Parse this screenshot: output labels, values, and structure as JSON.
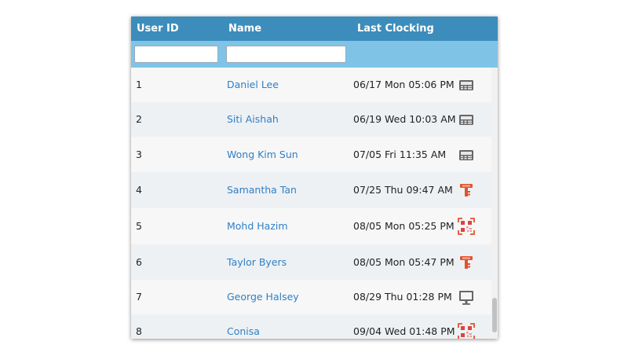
{
  "table": {
    "columns": [
      "User ID",
      "Name",
      "Last Clocking"
    ],
    "filters": {
      "user_id_value": "",
      "name_value": ""
    },
    "rows": [
      {
        "id": "1",
        "name": "Daniel Lee",
        "last": "06/17 Mon 05:06 PM",
        "icon": "terminal-icon"
      },
      {
        "id": "2",
        "name": "Siti Aishah",
        "last": "06/19 Wed 10:03 AM",
        "icon": "terminal-icon"
      },
      {
        "id": "3",
        "name": "Wong Kim Sun",
        "last": "07/05 Fri 11:35 AM",
        "icon": "terminal-icon"
      },
      {
        "id": "4",
        "name": "Samantha Tan",
        "last": "07/25 Thu 09:47 AM",
        "icon": "key-icon"
      },
      {
        "id": "5",
        "name": "Mohd Hazim",
        "last": "08/05 Mon 05:25 PM",
        "icon": "qr-code-icon"
      },
      {
        "id": "6",
        "name": "Taylor Byers",
        "last": "08/05 Mon 05:47 PM",
        "icon": "key-icon"
      },
      {
        "id": "7",
        "name": "George Halsey",
        "last": "08/29 Thu 01:28 PM",
        "icon": "monitor-icon"
      },
      {
        "id": "8",
        "name": "Conisa",
        "last": "09/04 Wed 01:48 PM",
        "icon": "qr-code-icon"
      }
    ]
  },
  "colors": {
    "header": "#3c8dbc",
    "filter_bar": "#7fc4e6",
    "name_link": "#2f7fc6",
    "row_odd": "#f7f7f7",
    "row_even": "#eef1f4",
    "key_icon": "#e0532f",
    "terminal_icon": "#666666"
  }
}
